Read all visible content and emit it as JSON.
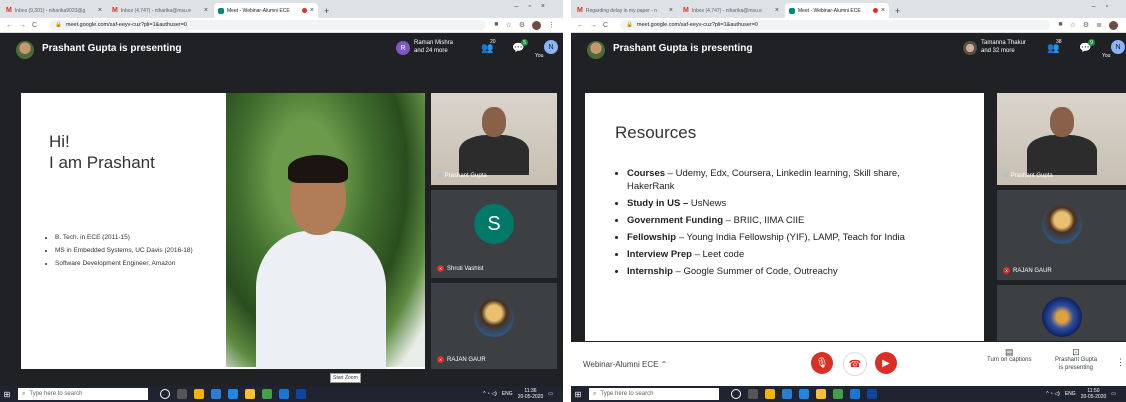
{
  "left": {
    "tabs": [
      {
        "label": "Inbox (9,301) - niharika9023@g",
        "kind": "gmail"
      },
      {
        "label": "Inbox (4,747) - niharika@msu.e",
        "kind": "gmail"
      },
      {
        "label": "Meet - Webinar-Alumni ECE",
        "kind": "meet",
        "recording": true
      }
    ],
    "url": "meet.google.com/saf-eeyv-cuz?pli=1&authuser=0",
    "presenting_text": "Prashant Gupta is presenting",
    "peer_avatar_letter": "R",
    "peer_name": "Raman Mishra",
    "peer_more": "and 24 more",
    "people_count": "20",
    "chat_badge": "5",
    "you_label": "You",
    "self_letter": "N",
    "slide": {
      "greeting_1": "Hi!",
      "greeting_2": "I am Prashant",
      "bullets": [
        "B. Tech. in ECE (2011-15)",
        "MS in Embedded Systems, UC Davis (2016-18)",
        "Software Development Engineer, Amazon"
      ]
    },
    "tiles": [
      {
        "name": "Prashant Gupta"
      },
      {
        "name": "Shruti Vashist",
        "letter": "S"
      },
      {
        "name": "RAJAN GAUR"
      }
    ],
    "tooltip": "Start Zoom",
    "taskbar": {
      "search_placeholder": "Type here to search",
      "time": "11:36",
      "date": "20-05-2020",
      "lang": "ENG"
    }
  },
  "right": {
    "tabs": [
      {
        "label": "Regarding delay in my paper - n",
        "kind": "gmail"
      },
      {
        "label": "Inbox (4,747) - niharika@msu.e",
        "kind": "gmail"
      },
      {
        "label": "Meet - Webinar-Alumni ECE",
        "kind": "meet",
        "recording": true
      }
    ],
    "url": "meet.google.com/saf-eeyv-cuz?pli=1&authuser=0",
    "presenting_text": "Prashant Gupta is presenting",
    "peer_name": "Tamanna Thakur",
    "peer_more": "and 32 more",
    "people_count": "38",
    "chat_badge": "9",
    "you_label": "You",
    "self_letter": "N",
    "slide": {
      "title": "Resources",
      "items": [
        {
          "bold": "Courses",
          "text": " – Udemy, Edx, Coursera, Linkedin learning, Skill share, HakerRank"
        },
        {
          "bold": "Study in US – ",
          "text": "UsNews"
        },
        {
          "bold": "Government Funding",
          "text": " – BRIIC, IIMA CIIE"
        },
        {
          "bold": "Fellowship",
          "text": " – Young India Fellowship (YIF), LAMP, Teach for India"
        },
        {
          "bold": "Interview Prep",
          "text": " – Leet code"
        },
        {
          "bold": "Internship",
          "text": " – Google Summer of Code, Outreachy"
        }
      ]
    },
    "tiles": [
      {
        "name": "Prashant Gupta"
      },
      {
        "name": "RAJAN GAUR"
      }
    ],
    "meeting_title": "Webinar-Alumni ECE",
    "captions_label": "Turn on captions",
    "presenting_label_1": "Prashant Gupta",
    "presenting_label_2": "is presenting",
    "taskbar": {
      "search_placeholder": "Type here to search",
      "time": "11:50",
      "date": "20-05-2020",
      "lang": "ENG"
    }
  },
  "colors": {
    "meet_bg": "#202124",
    "danger": "#d93025",
    "accent": "#1a73e8",
    "teal": "#00796b"
  }
}
